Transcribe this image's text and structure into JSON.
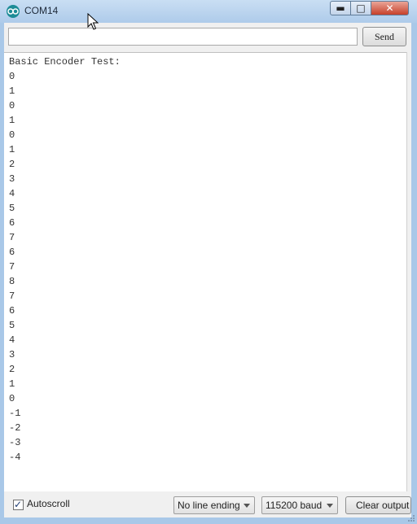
{
  "window": {
    "title": "COM14",
    "minimize_glyph": "▬",
    "maximize_glyph": "□",
    "close_glyph": "✕"
  },
  "toolbar": {
    "input_value": "",
    "send_label": "Send"
  },
  "output": {
    "lines": [
      "Basic Encoder Test:",
      "0",
      "1",
      "0",
      "1",
      "0",
      "1",
      "2",
      "3",
      "4",
      "5",
      "6",
      "7",
      "6",
      "7",
      "8",
      "7",
      "6",
      "5",
      "4",
      "3",
      "2",
      "1",
      "0",
      "-1",
      "-2",
      "-3",
      "-4"
    ]
  },
  "footer": {
    "autoscroll_checked": true,
    "autoscroll_label": "Autoscroll",
    "line_ending": "No line ending",
    "baud_rate": "115200 baud",
    "clear_label": "Clear output"
  },
  "icons": {
    "app": "arduino-icon",
    "minimize": "minimize-icon",
    "maximize": "maximize-icon",
    "close": "close-icon",
    "cursor": "mouse-cursor-icon",
    "checkbox": "checkmark-icon",
    "dropdown": "chevron-down-icon"
  },
  "colors": {
    "title_bar": "#aecbea",
    "close_button": "#c7402a",
    "app_icon": "#1d8c96",
    "output_background": "#ffffff"
  }
}
